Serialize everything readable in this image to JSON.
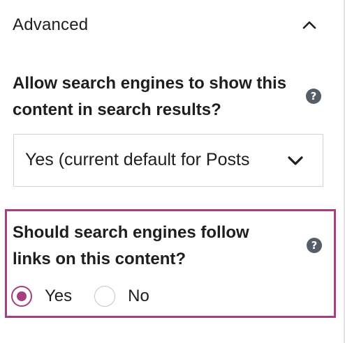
{
  "panel": {
    "title": "Advanced",
    "toggle_icon": "chevron-up-icon"
  },
  "robots_index": {
    "label": "Allow search engines to show this content in search results?",
    "help_icon": "question-mark-circle-icon",
    "help_glyph": "?",
    "select": {
      "value": "Yes (current default for Posts",
      "icon": "chevron-down-icon"
    }
  },
  "robots_follow": {
    "label": "Should search engines follow links on this content?",
    "help_icon": "question-mark-circle-icon",
    "help_glyph": "?",
    "options": [
      {
        "label": "Yes",
        "checked": true
      },
      {
        "label": "No",
        "checked": false
      }
    ],
    "highlight_color": "#a5407f"
  },
  "colors": {
    "accent": "#a5407f",
    "help_icon_bg": "#555d66",
    "text": "#1e1e1e",
    "border": "#d0d3d6"
  }
}
